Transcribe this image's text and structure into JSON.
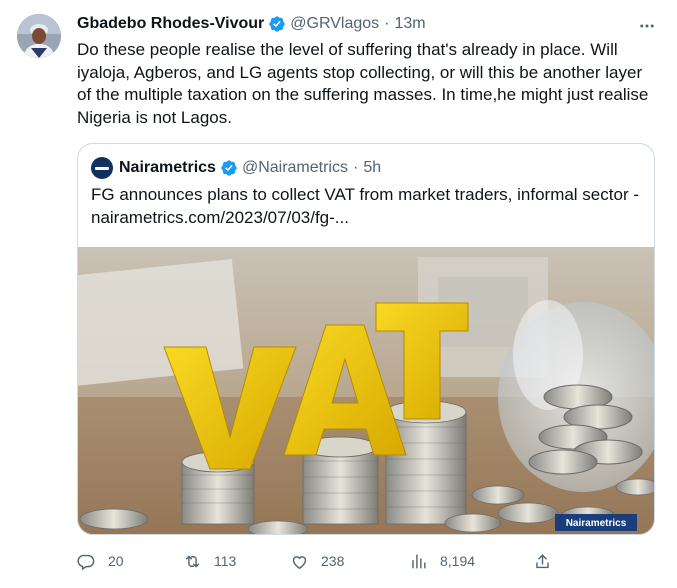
{
  "tweet": {
    "author_name": "Gbadebo Rhodes-Vivour",
    "handle": "@GRVlagos",
    "separator": "·",
    "time": "13m",
    "text": "Do these people realise the level of suffering that's already in place. Will iyaloja, Agberos, and LG agents stop collecting, or will this be another layer of the multiple taxation on the suffering masses. In time,he might just realise Nigeria is not Lagos."
  },
  "quote": {
    "author_name": "Nairametrics",
    "handle": "@Nairametrics",
    "separator": "·",
    "time": "5h",
    "text": "FG announces plans to collect VAT from market traders, informal sector - nairametrics.com/2023/07/03/fg-...",
    "image": {
      "headline_letters": "VAT",
      "watermark": "Nairametrics"
    }
  },
  "actions": {
    "replies": "20",
    "retweets": "113",
    "likes": "238",
    "views": "8,194"
  },
  "colors": {
    "verified": "#1d9bf0",
    "text": "#0f1419",
    "secondary": "#536471",
    "border": "#cfd9de",
    "vat_yellow": "#f2c500"
  },
  "icons": [
    "verified-badge-icon",
    "more-options-icon",
    "reply-icon",
    "retweet-icon",
    "like-icon",
    "views-icon",
    "share-icon"
  ]
}
